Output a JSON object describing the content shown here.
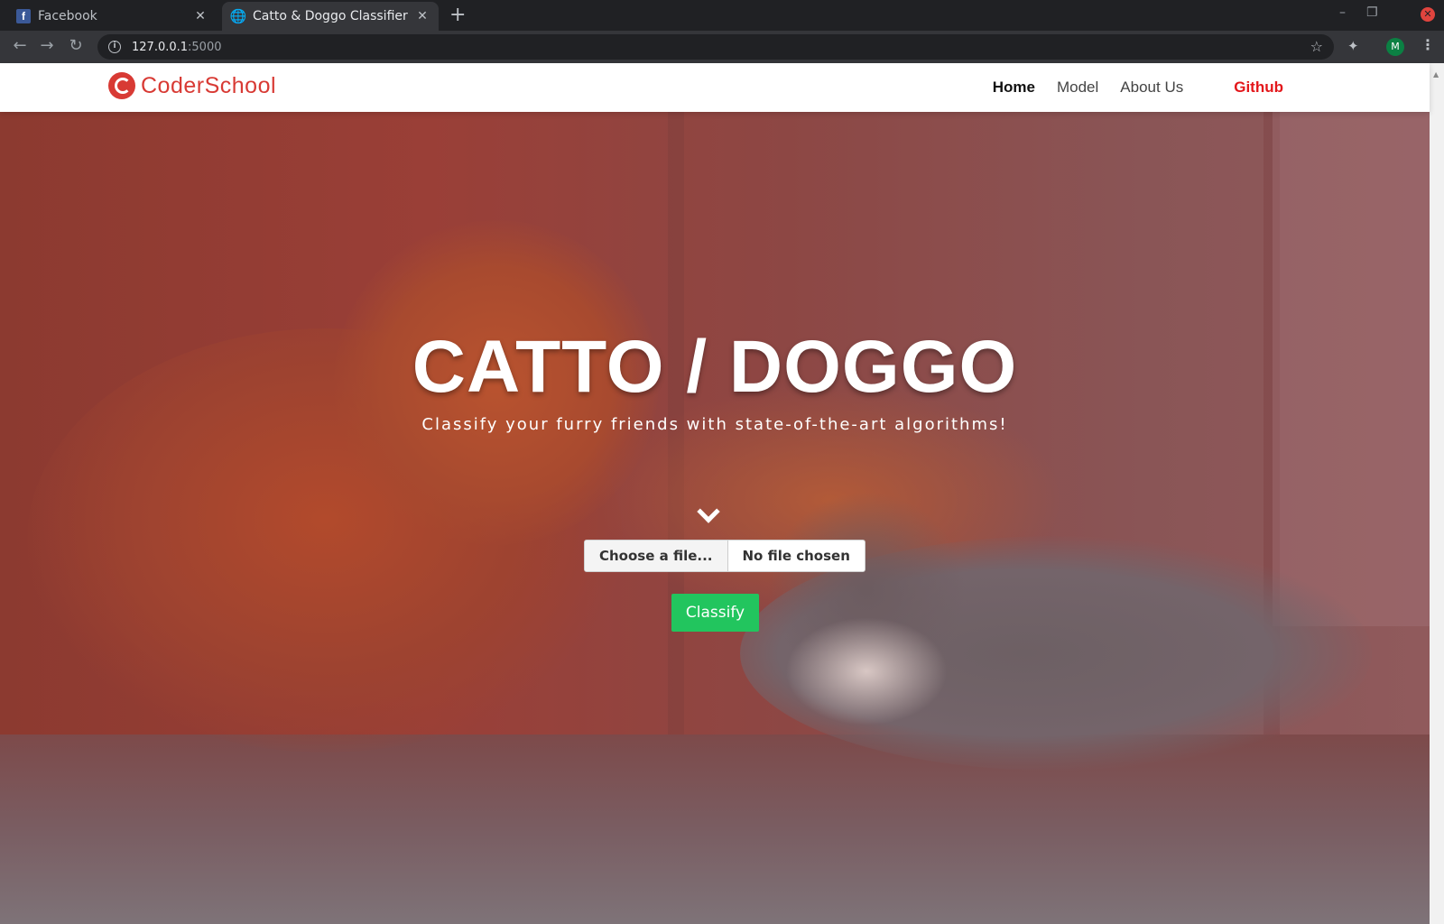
{
  "browser": {
    "tabs": [
      {
        "title": "Facebook",
        "icon": "facebook-icon"
      },
      {
        "title": "Catto & Doggo Classifier",
        "icon": "globe-icon"
      }
    ],
    "new_tab_label": "+",
    "url_host": "127.0.0.1",
    "url_port": ":5000",
    "profile_initial": "M"
  },
  "site": {
    "brand": "CoderSchool",
    "nav": {
      "home": "Home",
      "model": "Model",
      "about": "About Us",
      "github": "Github"
    },
    "colors": {
      "brand": "#d83a34",
      "github": "#e3171b",
      "classify": "#22c55e"
    }
  },
  "hero": {
    "title": "CATTO / DOGGO",
    "subtitle": "Classify your furry friends with state-of-the-art algorithms!",
    "file_button": "Choose a file...",
    "file_status": "No file chosen",
    "classify_button": "Classify"
  }
}
